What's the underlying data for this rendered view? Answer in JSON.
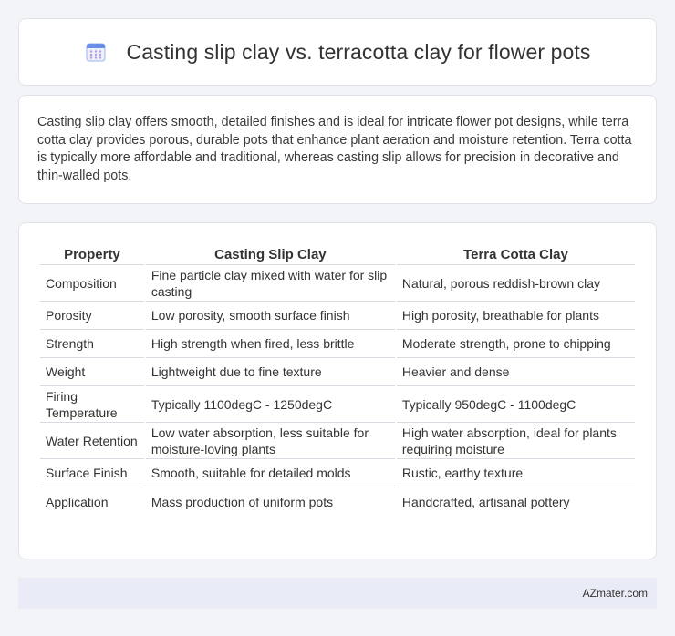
{
  "header": {
    "icon": "calendar-icon",
    "title": "Casting slip clay vs. terracotta clay for flower pots"
  },
  "summary": {
    "text": "Casting slip clay offers smooth, detailed finishes and is ideal for intricate flower pot designs, while terra cotta clay provides porous, durable pots that enhance plant aeration and moisture retention. Terra cotta is typically more affordable and traditional, whereas casting slip allows for precision in decorative and thin-walled pots."
  },
  "table": {
    "headers": [
      "Property",
      "Casting Slip Clay",
      "Terra Cotta Clay"
    ],
    "rows": [
      [
        "Composition",
        "Fine particle clay mixed with water for slip casting",
        "Natural, porous reddish-brown clay"
      ],
      [
        "Porosity",
        "Low porosity, smooth surface finish",
        "High porosity, breathable for plants"
      ],
      [
        "Strength",
        "High strength when fired, less brittle",
        "Moderate strength, prone to chipping"
      ],
      [
        "Weight",
        "Lightweight due to fine texture",
        "Heavier and dense"
      ],
      [
        "Firing Temperature",
        "Typically 1100degC - 1250degC",
        "Typically 950degC - 1100degC"
      ],
      [
        "Water Retention",
        "Low water absorption, less suitable for moisture-loving plants",
        "High water absorption, ideal for plants requiring moisture"
      ],
      [
        "Surface Finish",
        "Smooth, suitable for detailed molds",
        "Rustic, earthy texture"
      ],
      [
        "Application",
        "Mass production of uniform pots",
        "Handcrafted, artisanal pottery"
      ]
    ]
  },
  "footer": {
    "brand": "AZmater.com"
  },
  "colors": {
    "background": "#f3f4f8",
    "card": "#ffffff",
    "footer": "#e9ecf6",
    "icon_accent": "#6b8fe8",
    "icon_dots": "#b59ce6"
  }
}
